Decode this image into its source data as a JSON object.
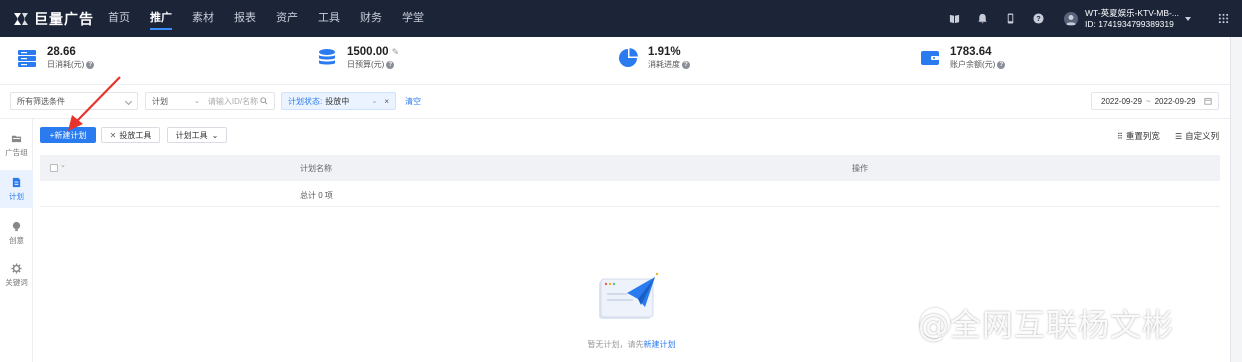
{
  "nav": {
    "logo_text": "巨量广告",
    "items": [
      {
        "label": "首页"
      },
      {
        "label": "推广"
      },
      {
        "label": "素材"
      },
      {
        "label": "报表"
      },
      {
        "label": "资产"
      },
      {
        "label": "工具"
      },
      {
        "label": "财务"
      },
      {
        "label": "学堂"
      }
    ],
    "active_item": "推广",
    "user_name": "WT-英夏娱乐-KTV-MB-...",
    "user_id": "ID: 1741934799389319"
  },
  "stats": [
    {
      "value": "28.66",
      "label": "日消耗(元)",
      "icon": "server-icon"
    },
    {
      "value": "1500.00",
      "label": "日预算(元)",
      "icon": "database-icon"
    },
    {
      "value": "1.91%",
      "label": "消耗进度",
      "icon": "pie-icon"
    },
    {
      "value": "1783.64",
      "label": "账户余额(元)",
      "icon": "wallet-icon"
    }
  ],
  "filters": {
    "preset": "所有筛选条件",
    "scope": "计划",
    "search_placeholder": "请输入ID/名称",
    "status_label": "计划状态:",
    "status_value": "投放中",
    "clear": "清空",
    "date_start": "2022-09-29",
    "date_sep": "~",
    "date_end": "2022-09-29"
  },
  "sidebar": [
    {
      "label": "广告组",
      "icon": "folder-icon"
    },
    {
      "label": "计划",
      "icon": "plan-icon"
    },
    {
      "label": "创意",
      "icon": "bulb-icon"
    },
    {
      "label": "关键词",
      "icon": "gear-icon"
    }
  ],
  "toolbar": {
    "new_plan": "+新建计划",
    "delivery_tool": "投放工具",
    "plan_tool": "计划工具",
    "reset_columns": "重置列宽",
    "custom_columns": "自定义列"
  },
  "table": {
    "columns": [
      "计划名称",
      "操作"
    ],
    "summary": "总计 0 项"
  },
  "empty": {
    "text": "暂无计划，请先",
    "link": "新建计划"
  },
  "watermark": "@全网互联杨文彬",
  "colors": {
    "nav_bg": "#1c2438",
    "accent": "#2a7bf0",
    "arrow": "#e8322e"
  }
}
